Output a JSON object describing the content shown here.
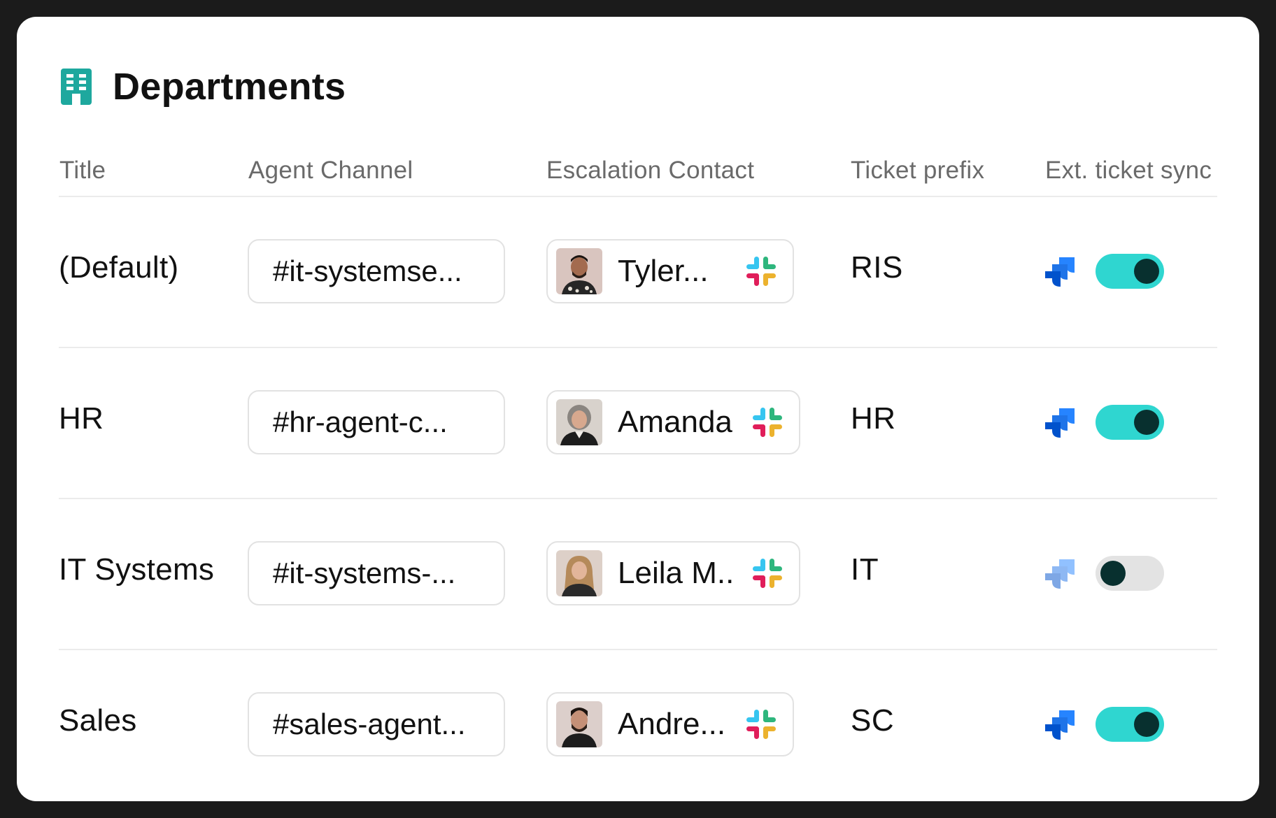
{
  "page": {
    "title": "Departments",
    "icon": "building-icon",
    "accent_color": "#1ea89e"
  },
  "columns": {
    "title": "Title",
    "agent_channel": "Agent Channel",
    "escalation_contact": "Escalation Contact",
    "ticket_prefix": "Ticket prefix",
    "ext_ticket_sync": "Ext. ticket sync"
  },
  "rows": [
    {
      "title": "(Default)",
      "channel": "#it-systemse...",
      "contact_name": "Tyler...",
      "contact_icon": "slack-icon",
      "prefix": "RIS",
      "sync_icon": "jira-icon",
      "sync_enabled": true
    },
    {
      "title": "HR",
      "channel": "#hr-agent-c...",
      "contact_name": "Amanda",
      "contact_icon": "slack-icon",
      "prefix": "HR",
      "sync_icon": "jira-icon",
      "sync_enabled": true
    },
    {
      "title": "IT Systems",
      "channel": "#it-systems-...",
      "contact_name": "Leila M..",
      "contact_icon": "slack-icon",
      "prefix": "IT",
      "sync_icon": "jira-icon",
      "sync_enabled": false
    },
    {
      "title": "Sales",
      "channel": "#sales-agent...",
      "contact_name": "Andre...",
      "contact_icon": "slack-icon",
      "prefix": "SC",
      "sync_icon": "jira-icon",
      "sync_enabled": true
    }
  ],
  "colors": {
    "toggle_on": "#2fd6d0",
    "toggle_off": "#e3e3e3",
    "toggle_knob": "#08302f",
    "jira_blue": "#2684ff"
  }
}
